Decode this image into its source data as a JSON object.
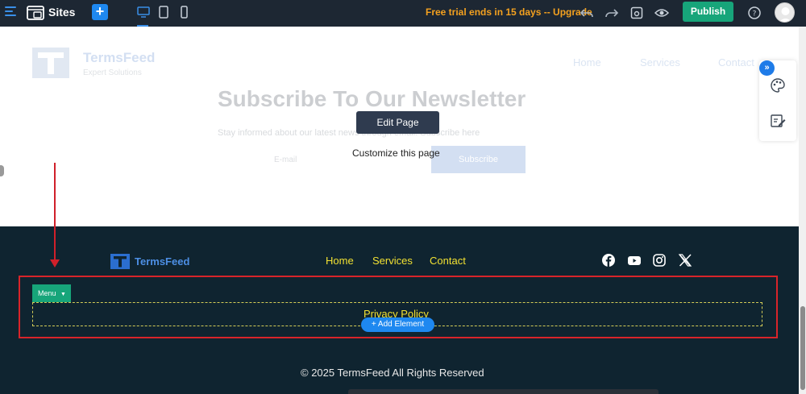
{
  "topbar": {
    "sites_label": "Sites",
    "trial_text": "Free trial ends in 15 days -- Upgrade",
    "publish_label": "Publish",
    "icons": [
      "menu-icon",
      "sites-icon",
      "plus-icon",
      "desktop-icon",
      "tablet-icon",
      "mobile-icon",
      "undo-icon",
      "redo-icon",
      "save-icon",
      "preview-icon",
      "help-icon",
      "avatar"
    ]
  },
  "header": {
    "logo_name": "TermsFeed",
    "logo_subtitle": "Expert Solutions",
    "nav": [
      "Home",
      "Services",
      "Contact"
    ]
  },
  "hero": {
    "title": "Subscribe To Our Newsletter",
    "description": "Stay informed about our latest news through email. Subscribe here",
    "email_placeholder": "E-mail",
    "subscribe_label": "Subscribe"
  },
  "overlay": {
    "edit_page_label": "Edit Page",
    "customize_text": "Customize this page"
  },
  "side_tools": {
    "expand_label": "»",
    "icons": [
      "palette-icon",
      "edit-note-icon"
    ]
  },
  "footer": {
    "logo_name": "TermsFeed",
    "nav": [
      "Home",
      "Services",
      "Contact"
    ],
    "social_icons": [
      "facebook-icon",
      "youtube-icon",
      "instagram-icon",
      "x-icon"
    ],
    "menu_tag_label": "Menu",
    "privacy_link": "Privacy Policy",
    "add_element_label": "+ Add Element",
    "copyright": "© 2025 TermsFeed All Rights Reserved"
  },
  "colors": {
    "topbar_bg": "#1d2733",
    "accent_blue": "#1e88f0",
    "publish_green": "#17a57a",
    "trial_orange": "#f4a11f",
    "footer_bg": "#0f2430",
    "footer_link_yellow": "#f2e132",
    "highlight_red": "#d8242a"
  }
}
